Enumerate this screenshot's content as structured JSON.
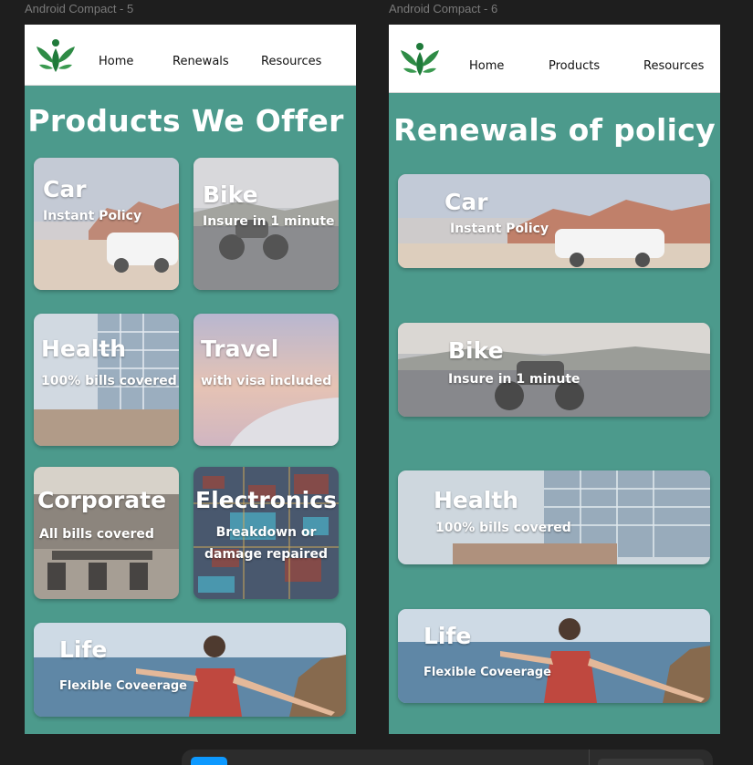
{
  "frames": [
    {
      "label": "Android Compact - 5",
      "nav": [
        "Home",
        "Renewals",
        "Resources"
      ],
      "title": "Products We Offer",
      "cards": [
        {
          "title": "Car",
          "subtitle": "Instant Policy",
          "scene": "car"
        },
        {
          "title": "Bike",
          "subtitle": "Insure in 1 minute",
          "scene": "bike"
        },
        {
          "title": "Health",
          "subtitle": "100% bills covered",
          "scene": "health"
        },
        {
          "title": "Travel",
          "subtitle": "with visa included",
          "scene": "travel"
        },
        {
          "title": "Corporate",
          "subtitle": "All bills covered",
          "scene": "corporate"
        },
        {
          "title": "Electronics",
          "subtitle": "Breakdown or damage repaired",
          "scene": "electronics"
        },
        {
          "title": "Life",
          "subtitle": "Flexible Coveerage",
          "scene": "life"
        }
      ]
    },
    {
      "label": "Android Compact - 6",
      "nav": [
        "Home",
        "Products",
        "Resources"
      ],
      "title": "Renewals of policy",
      "cards": [
        {
          "title": "Car",
          "subtitle": "Instant Policy",
          "scene": "car"
        },
        {
          "title": "Bike",
          "subtitle": "Insure in 1 minute",
          "scene": "bike"
        },
        {
          "title": "Health",
          "subtitle": "100% bills covered",
          "scene": "health"
        },
        {
          "title": "Life",
          "subtitle": "Flexible Coveerage",
          "scene": "life"
        }
      ]
    }
  ],
  "colors": {
    "frame_bg": "#4c9a8c",
    "navbar_bg": "#ffffff",
    "logo_green": "#1f7a3a",
    "canvas_bg": "#1e1e1e"
  },
  "icons": {
    "logo": "leaf-person-logo-icon"
  }
}
